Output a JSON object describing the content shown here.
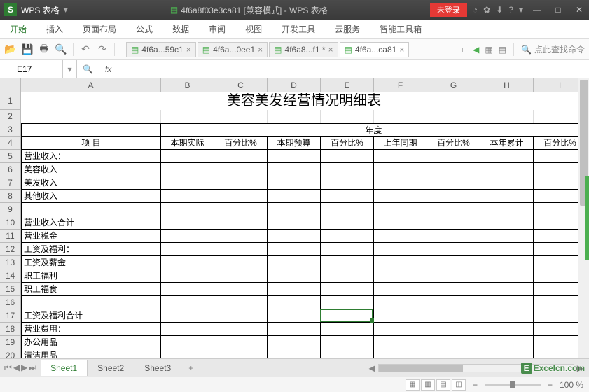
{
  "app": {
    "name": "WPS 表格",
    "logo": "S"
  },
  "titlebar": {
    "doc_name": "4f6a8f03e3ca81 [兼容模式] - WPS 表格",
    "login": "未登录",
    "sys_icons": [
      "◔",
      "✿",
      "⬇",
      "?",
      "▾"
    ]
  },
  "menus": [
    "开始",
    "插入",
    "页面布局",
    "公式",
    "数据",
    "审阅",
    "视图",
    "开发工具",
    "云服务",
    "智能工具箱"
  ],
  "active_menu": 0,
  "doc_tabs": [
    {
      "label": "4f6a...59c1",
      "active": false
    },
    {
      "label": "4f6a...0ee1",
      "active": false
    },
    {
      "label": "4f6a8...f1 *",
      "active": false
    },
    {
      "label": "4f6a...ca81",
      "active": true
    }
  ],
  "search_placeholder": "点此查找命令",
  "name_box": "E17",
  "fx_label": "fx",
  "formula_value": "",
  "columns": [
    "A",
    "B",
    "C",
    "D",
    "E",
    "F",
    "G",
    "H",
    "I"
  ],
  "row_count": 20,
  "selected": {
    "row": 17,
    "col": "E"
  },
  "sheet": {
    "title": "美容美发经营情况明细表",
    "year_label": "年度",
    "header": {
      "A": "项          目",
      "B": "本期实际",
      "C": "百分比%",
      "D": "本期预算",
      "E": "百分比%",
      "F": "上年同期",
      "G": "百分比%",
      "H": "本年累计",
      "I": "百分比%"
    },
    "rows": {
      "5": "营业收入：",
      "6": "  美容收入",
      "7": "  美发收入",
      "8": "  其他收入",
      "9": "",
      "10": "      营业收入合计",
      "11": "营业税金",
      "12": "工资及福利：",
      "13": "  工资及薪金",
      "14": "  职工福利",
      "15": "  职工福食",
      "16": "",
      "17": "      工资及福利合计",
      "18": "营业费用：",
      "19": "  办公用品",
      "20": "  清洁用品"
    }
  },
  "sheet_tabs": [
    "Sheet1",
    "Sheet2",
    "Sheet3"
  ],
  "active_sheet": 0,
  "zoom": "100 %",
  "watermark": "Excelcn.com"
}
